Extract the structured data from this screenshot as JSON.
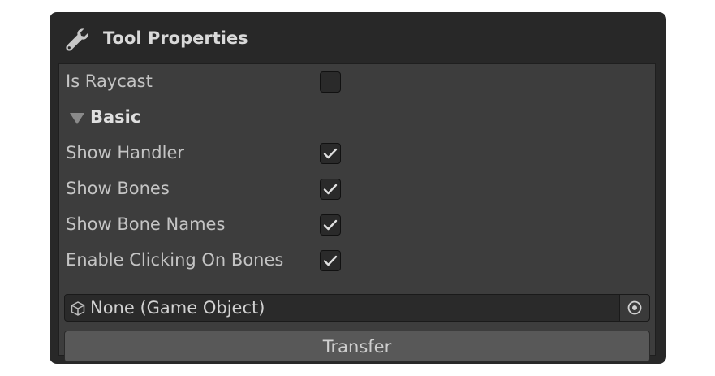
{
  "header": {
    "title": "Tool Properties",
    "icon": "wrench-icon"
  },
  "fields": {
    "is_raycast": {
      "label": "Is Raycast",
      "checked": false
    },
    "basic_foldout": {
      "label": "Basic",
      "expanded": true
    },
    "show_handler": {
      "label": "Show Handler",
      "checked": true
    },
    "show_bones": {
      "label": "Show Bones",
      "checked": true
    },
    "show_bone_names": {
      "label": "Show Bone Names",
      "checked": true
    },
    "enable_clicking_on_bones": {
      "label": "Enable Clicking On Bones",
      "checked": true
    }
  },
  "object_field": {
    "value": "None (Game Object)",
    "icon": "cube-icon",
    "picker_icon": "target-icon"
  },
  "transfer_button": {
    "label": "Transfer"
  },
  "colors": {
    "panel_bg": "#282828",
    "content_bg": "#3d3d3d",
    "button_bg": "#585858",
    "text": "#c4c4c4"
  }
}
